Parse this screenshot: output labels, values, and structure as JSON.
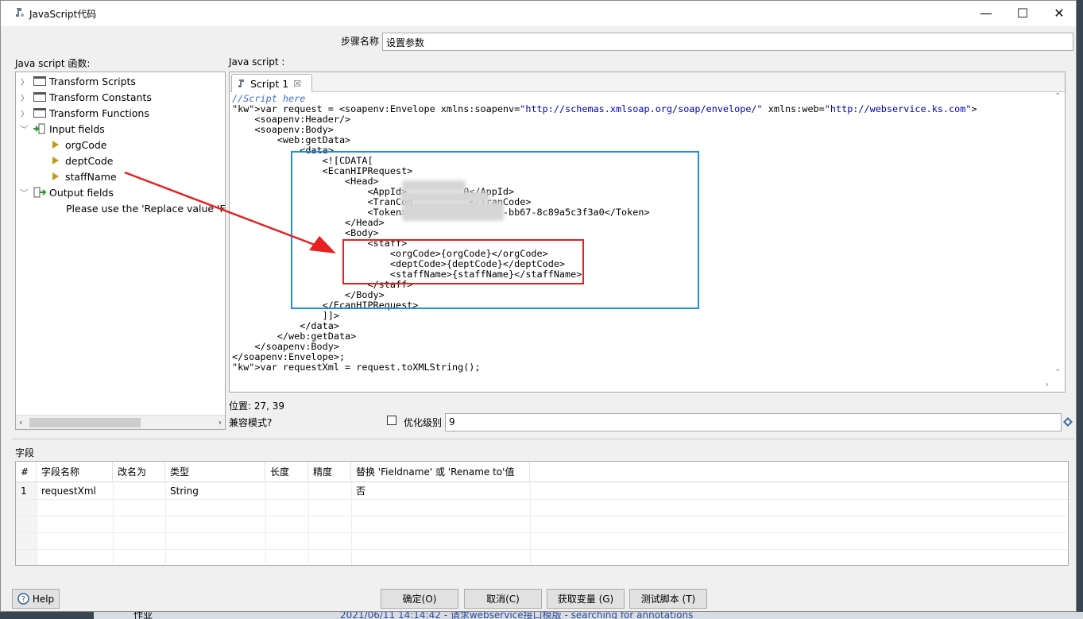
{
  "window": {
    "title": "JavaScript代码",
    "minimize": "—",
    "maximize": "☐",
    "close": "✕"
  },
  "step": {
    "label": "步骤名称",
    "value": "设置参数"
  },
  "functions_panel": {
    "label": "Java script 函数:",
    "items": [
      {
        "label": "Transform Scripts",
        "kind": "folder"
      },
      {
        "label": "Transform Constants",
        "kind": "folder"
      },
      {
        "label": "Transform Functions",
        "kind": "folder"
      },
      {
        "label": "Input fields",
        "kind": "input"
      },
      {
        "label": "orgCode",
        "kind": "field"
      },
      {
        "label": "deptCode",
        "kind": "field"
      },
      {
        "label": "staffName",
        "kind": "field"
      },
      {
        "label": "Output fields",
        "kind": "output"
      },
      {
        "label": "Please use the 'Replace value 'Fiel",
        "kind": "note"
      }
    ]
  },
  "script_panel": {
    "label": "Java script :",
    "tab_label": "Script 1",
    "tab_close": "☒",
    "lines": [
      "//Script here",
      "var request = <soapenv:Envelope xmlns:soapenv=\"http://schemas.xmlsoap.org/soap/envelope/\" xmlns:web=\"http://webservice.ks.com\">",
      "    <soapenv:Header/>",
      "    <soapenv:Body>",
      "        <web:getData>",
      "            <data>",
      "                <![CDATA[",
      "                <EcanHIPRequest>",
      "                    <Head>",
      "                        <AppId>          0</AppId>",
      "                        <TranCod          </TranCode>",
      "                        <Token>5e               -bb67-8c89a5c3f3a0</Token>",
      "                    </Head>",
      "                    <Body>",
      "                        <staff>",
      "                            <orgCode>{orgCode}</orgCode>",
      "                            <deptCode>{deptCode}</deptCode>",
      "                            <staffName>{staffName}</staffName>",
      "                        </staff>",
      "                    </Body>",
      "                </EcanHIPRequest>",
      "                ]]>",
      "            </data>",
      "        </web:getData>",
      "    </soapenv:Body>",
      "</soapenv:Envelope>;",
      "var requestXml = request.toXMLString();"
    ]
  },
  "position": "位置: 27, 39",
  "compat": {
    "label": "兼容模式?",
    "optimize_label": "优化级别",
    "optimize_value": "9"
  },
  "fields_section": {
    "label": "字段",
    "columns": [
      "#",
      "字段名称",
      "改名为",
      "类型",
      "长度",
      "精度",
      "替换 'Fieldname' 或 'Rename to'值"
    ],
    "rows": [
      [
        "1",
        "requestXml",
        "",
        "String",
        "",
        "",
        "否"
      ]
    ]
  },
  "buttons": {
    "help": "Help",
    "ok": "确定(O)",
    "cancel": "取消(C)",
    "get_vars": "获取变量 (G)",
    "test": "测试脚本 (T)"
  },
  "background_bar": {
    "text": "2021/06/11 14:14:42 - 请求webservice接口模版 - searching for annotations",
    "side_label": "作业"
  }
}
